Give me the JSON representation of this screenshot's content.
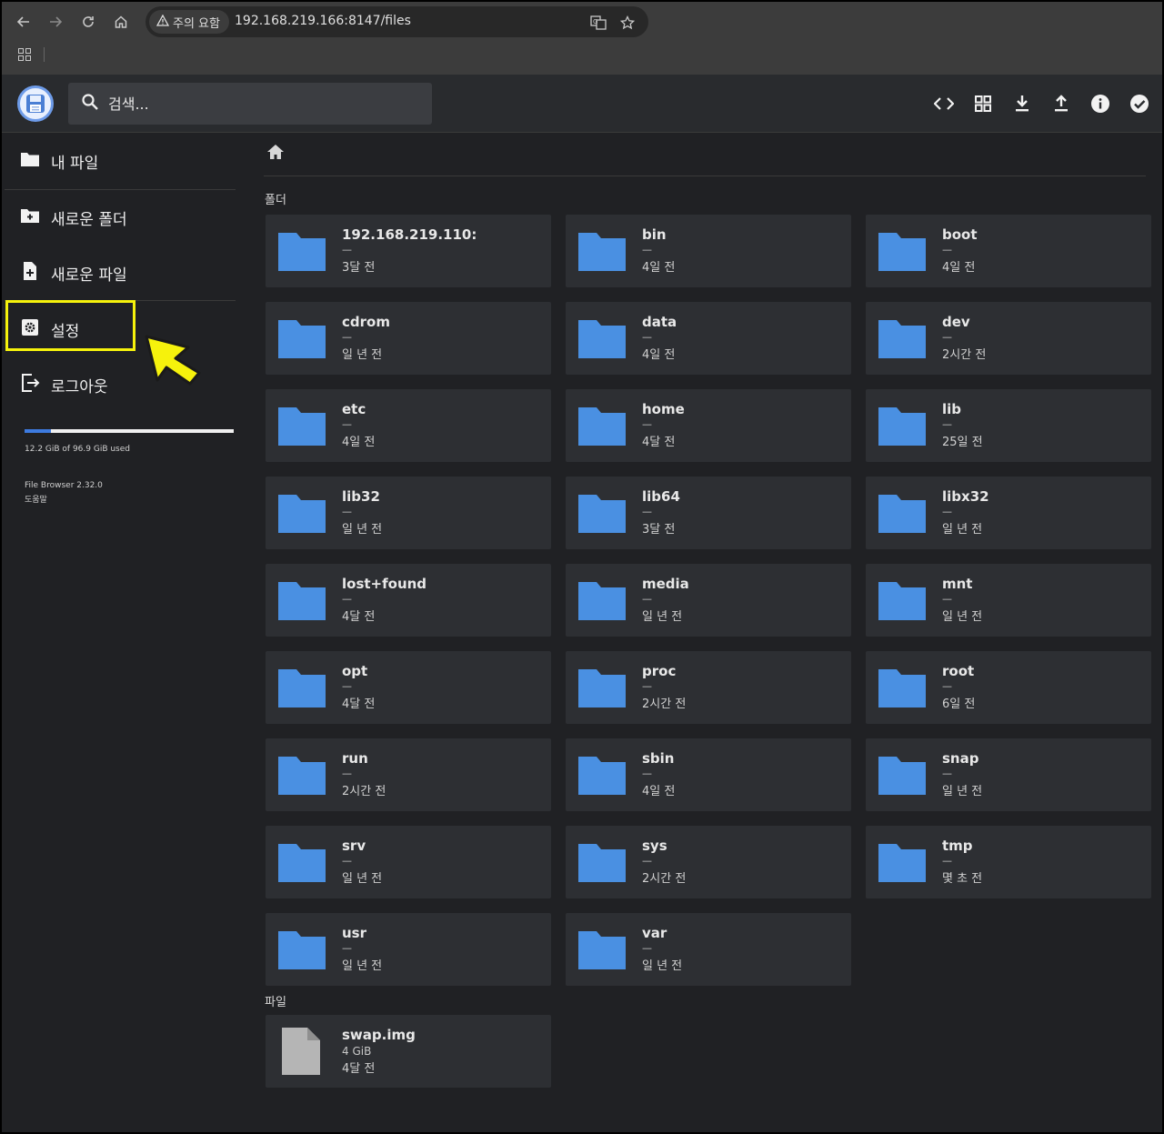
{
  "browser": {
    "security_chip": "주의 요함",
    "url": "192.168.219.166:8147/files"
  },
  "header": {
    "search_placeholder": "검색...",
    "actions": [
      "code-icon",
      "grid-view-icon",
      "download-icon",
      "upload-icon",
      "info-icon",
      "check-circle-icon"
    ]
  },
  "sidebar": {
    "my_files": "내 파일",
    "new_folder": "새로운 폴더",
    "new_file": "새로운 파일",
    "settings": "설정",
    "logout": "로그아웃",
    "usage_text": "12.2 GiB of 96.9 GiB used",
    "usage_fraction": 0.126,
    "version": "File Browser 2.32.0",
    "help": "도움말"
  },
  "main": {
    "folders_title": "폴더",
    "files_title": "파일",
    "folders": [
      {
        "name": "192.168.219.110:",
        "size": "—",
        "date": "3달 전"
      },
      {
        "name": "bin",
        "size": "—",
        "date": "4일 전"
      },
      {
        "name": "boot",
        "size": "—",
        "date": "4일 전"
      },
      {
        "name": "cdrom",
        "size": "—",
        "date": "일 년 전"
      },
      {
        "name": "data",
        "size": "—",
        "date": "4일 전"
      },
      {
        "name": "dev",
        "size": "—",
        "date": "2시간 전"
      },
      {
        "name": "etc",
        "size": "—",
        "date": "4일 전"
      },
      {
        "name": "home",
        "size": "—",
        "date": "4달 전"
      },
      {
        "name": "lib",
        "size": "—",
        "date": "25일 전"
      },
      {
        "name": "lib32",
        "size": "—",
        "date": "일 년 전"
      },
      {
        "name": "lib64",
        "size": "—",
        "date": "3달 전"
      },
      {
        "name": "libx32",
        "size": "—",
        "date": "일 년 전"
      },
      {
        "name": "lost+found",
        "size": "—",
        "date": "4달 전"
      },
      {
        "name": "media",
        "size": "—",
        "date": "일 년 전"
      },
      {
        "name": "mnt",
        "size": "—",
        "date": "일 년 전"
      },
      {
        "name": "opt",
        "size": "—",
        "date": "4달 전"
      },
      {
        "name": "proc",
        "size": "—",
        "date": "2시간 전"
      },
      {
        "name": "root",
        "size": "—",
        "date": "6일 전"
      },
      {
        "name": "run",
        "size": "—",
        "date": "2시간 전"
      },
      {
        "name": "sbin",
        "size": "—",
        "date": "4일 전"
      },
      {
        "name": "snap",
        "size": "—",
        "date": "일 년 전"
      },
      {
        "name": "srv",
        "size": "—",
        "date": "일 년 전"
      },
      {
        "name": "sys",
        "size": "—",
        "date": "2시간 전"
      },
      {
        "name": "tmp",
        "size": "—",
        "date": "몇 초 전"
      },
      {
        "name": "usr",
        "size": "—",
        "date": "일 년 전"
      },
      {
        "name": "var",
        "size": "—",
        "date": "일 년 전"
      }
    ],
    "files": [
      {
        "name": "swap.img",
        "size": "4 GiB",
        "date": "4달 전"
      }
    ]
  },
  "colors": {
    "folder": "#4a90e2",
    "highlight": "#f6f20c",
    "accent": "#3d7be0"
  }
}
